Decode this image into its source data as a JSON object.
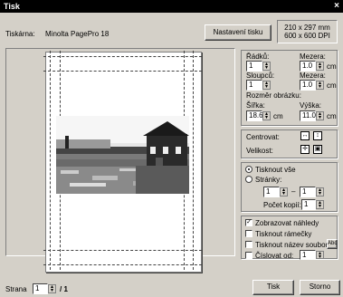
{
  "window": {
    "title": "Tisk",
    "close": "×"
  },
  "printer": {
    "label": "Tiskárna:",
    "name": "Minolta PagePro 18",
    "setup_button": "Nastavení tisku",
    "paper": "210 x 297 mm",
    "resolution": "600 x 600 DPI"
  },
  "layout": {
    "rows_label": "Řádků:",
    "rows_value": "1",
    "row_gap_label": "Mezera:",
    "row_gap_value": "1.0",
    "row_gap_unit": "cm",
    "cols_label": "Sloupců:",
    "cols_value": "1",
    "col_gap_label": "Mezera:",
    "col_gap_value": "1.0",
    "col_gap_unit": "cm",
    "size_label": "Rozměr obrázku:",
    "width_label": "Šířka:",
    "width_value": "18.6",
    "width_unit": "cm",
    "height_label": "Výška:",
    "height_value": "11.0",
    "height_unit": "cm"
  },
  "placement": {
    "center_label": "Centrovat:",
    "size_label": "Velikost:"
  },
  "range": {
    "all_label": "Tisknout vše",
    "all_selected": true,
    "pages_label": "Stránky:",
    "from_value": "1",
    "dash": "–",
    "to_value": "1",
    "copies_label": "Počet kopií:",
    "copies_value": "1"
  },
  "options": {
    "show_preview": "Zobrazovat náhledy",
    "print_frames": "Tisknout rámečky",
    "print_filename": "Tisknout název souboru",
    "font_button": "Abc",
    "number_from": "Číslovat od:",
    "number_from_value": "1"
  },
  "footer": {
    "page_label": "Strana",
    "page_value": "1",
    "page_total": "/ 1",
    "print_button": "Tisk",
    "cancel_button": "Storno"
  },
  "colors": {
    "face": "#d4d0c8",
    "titlebar": "#000000",
    "sky": "#ffffff"
  }
}
